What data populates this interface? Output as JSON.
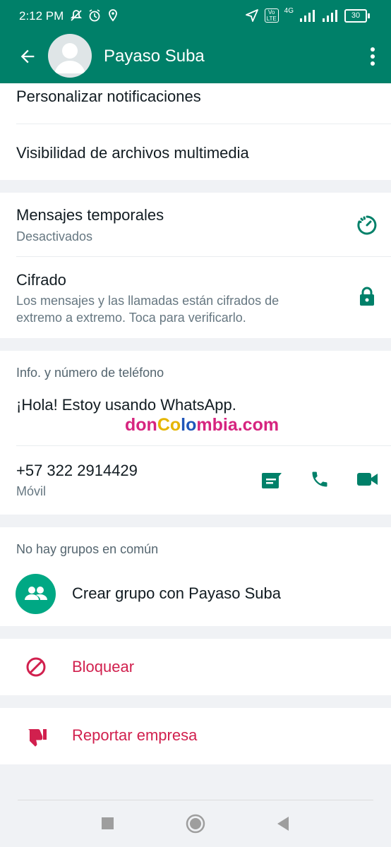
{
  "status_bar": {
    "time": "2:12 PM",
    "battery": "30",
    "network_4g": "4G"
  },
  "header": {
    "contact_name": "Payaso Suba"
  },
  "section1": {
    "notifications_label": "Personalizar notificaciones",
    "media_visibility_label": "Visibilidad de archivos multimedia"
  },
  "section2": {
    "temp_messages_title": "Mensajes temporales",
    "temp_messages_status": "Desactivados",
    "encryption_title": "Cifrado",
    "encryption_desc_line1": "Los mensajes y las llamadas están cifrados de",
    "encryption_desc_line2": "extremo a extremo. Toca para verificarlo."
  },
  "section3": {
    "header": "Info. y número de teléfono",
    "about": "¡Hola! Estoy usando WhatsApp.",
    "watermark_parts": [
      "don",
      "Co",
      "lo",
      "mb",
      "ia",
      ".com"
    ],
    "phone": "+57 322 2914429",
    "phone_type": "Móvil"
  },
  "section4": {
    "header": "No hay grupos en común",
    "create_group": "Crear grupo con Payaso Suba"
  },
  "actions": {
    "block": "Bloquear",
    "report": "Reportar empresa"
  },
  "colors": {
    "brand": "#008069",
    "danger": "#d1204e"
  }
}
